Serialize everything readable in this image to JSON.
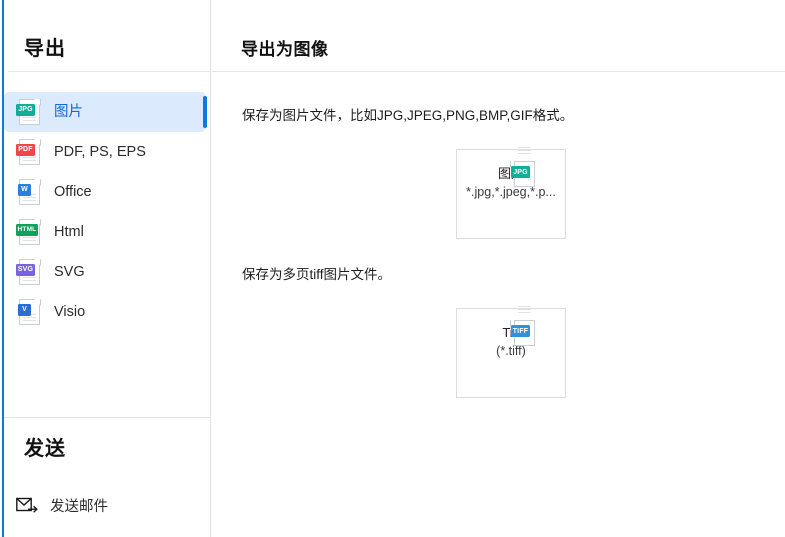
{
  "accent_color": "#0b7ae5",
  "sidebar": {
    "title": "导出",
    "items": [
      {
        "label": "图片",
        "icon": "jpg-file-icon",
        "badge": "JPG",
        "badge_color": "#0fae96",
        "selected": true
      },
      {
        "label": "PDF, PS, EPS",
        "icon": "pdf-file-icon",
        "badge": "PDF",
        "badge_color": "#f0454b",
        "selected": false
      },
      {
        "label": "Office",
        "icon": "office-file-icon",
        "badge": "W",
        "badge_color": "#2a7fe0",
        "selected": false
      },
      {
        "label": "Html",
        "icon": "html-file-icon",
        "badge": "HTML",
        "badge_color": "#12a05c",
        "selected": false
      },
      {
        "label": "SVG",
        "icon": "svg-file-icon",
        "badge": "SVG",
        "badge_color": "#7b62e0",
        "selected": false
      },
      {
        "label": "Visio",
        "icon": "visio-file-icon",
        "badge": "V",
        "badge_color": "#2a6fd0",
        "selected": false
      }
    ],
    "send_section": {
      "title": "发送",
      "item_label": "发送邮件",
      "item_icon": "send-mail-icon"
    }
  },
  "main": {
    "title": "导出为图像",
    "sections": [
      {
        "description": "保存为图片文件，比如JPG,JPEG,PNG,BMP,GIF格式。",
        "card": {
          "name": "图片",
          "extensions": "*.jpg,*.jpeg,*.p...",
          "badge": "JPG",
          "badge_color": "#0fae96",
          "icon": "jpg-file-icon"
        }
      },
      {
        "description": "保存为多页tiff图片文件。",
        "card": {
          "name": "Tiff",
          "extensions": "(*.tiff)",
          "badge": "TIFF",
          "badge_color": "#2f93d6",
          "icon": "tiff-file-icon"
        }
      }
    ]
  }
}
